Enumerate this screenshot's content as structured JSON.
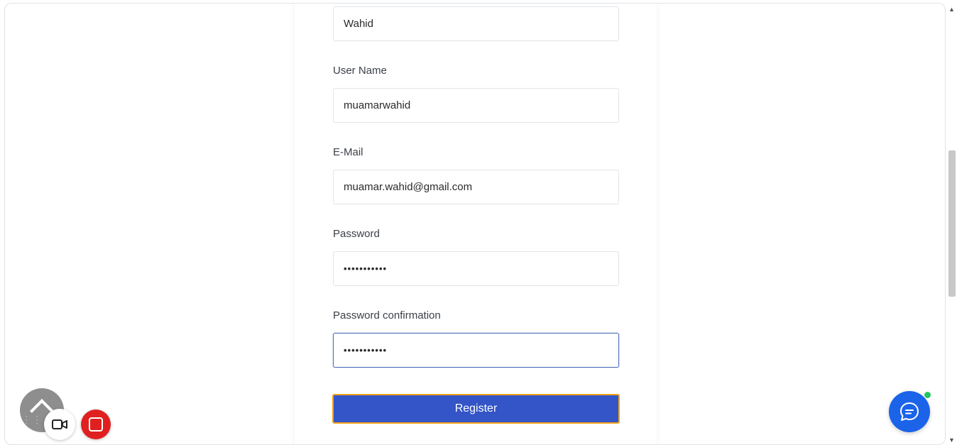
{
  "form": {
    "first_field_value": "Wahid",
    "username_label": "User Name",
    "username_value": "muamarwahid",
    "email_label": "E-Mail",
    "email_value": "muamar.wahid@gmail.com",
    "password_label": "Password",
    "password_value": "•••••••••••",
    "password_confirm_label": "Password confirmation",
    "password_confirm_value": "•••••••••••",
    "register_label": "Register"
  },
  "icons": {
    "scroll_up": "▲",
    "scroll_down": "▼",
    "drag_handle": "⋮⋮",
    "camera": "video-camera-icon",
    "stop": "stop-icon",
    "chat": "chat-bubble-icon"
  },
  "colors": {
    "primary_button": "#3455c8",
    "focus_outline": "#f3a31a",
    "chat_button": "#1b63e8",
    "stop_button": "#e02020",
    "online_indicator": "#22c55e"
  }
}
